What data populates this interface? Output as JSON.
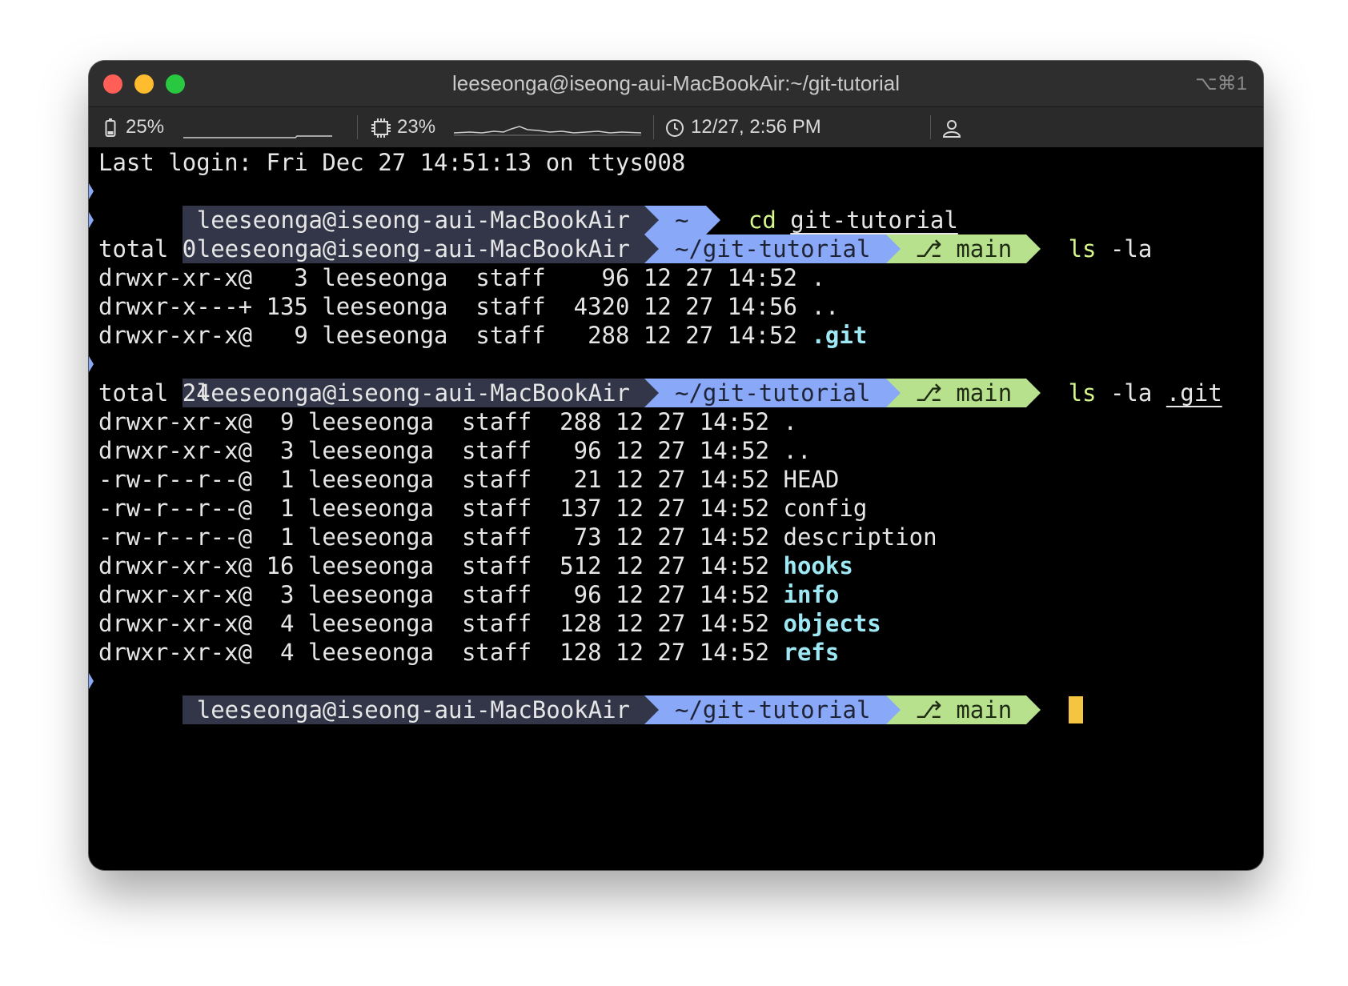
{
  "window": {
    "title": "leeseonga@iseong-aui-MacBookAir:~/git-tutorial",
    "shortcut": "⌥⌘1"
  },
  "statusbar": {
    "battery": "25%",
    "cpu": "23%",
    "datetime": "12/27, 2:56 PM"
  },
  "terminal": {
    "last_login": "Last login: Fri Dec 27 14:51:13 on ttys008",
    "prompt": {
      "user": "leeseonga@iseong-aui-MacBookAir",
      "home": "~",
      "dir": "~/git-tutorial",
      "branch": "main"
    },
    "cmd1": {
      "name": "cd",
      "arg": "git-tutorial"
    },
    "cmd2": {
      "name": "ls",
      "args": "-la"
    },
    "cmd3": {
      "name": "ls",
      "args": "-la",
      "path": ".git"
    },
    "listing1": {
      "total": "total 0",
      "rows": [
        {
          "text": "drwxr-xr-x@   3 leeseonga  staff    96 12 27 14:52 ",
          "name": ".",
          "dir": false
        },
        {
          "text": "drwxr-x---+ 135 leeseonga  staff  4320 12 27 14:56 ",
          "name": "..",
          "dir": false
        },
        {
          "text": "drwxr-xr-x@   9 leeseonga  staff   288 12 27 14:52 ",
          "name": ".git",
          "dir": true
        }
      ]
    },
    "listing2": {
      "total": "total 24",
      "rows": [
        {
          "text": "drwxr-xr-x@  9 leeseonga  staff  288 12 27 14:52 ",
          "name": ".",
          "dir": false
        },
        {
          "text": "drwxr-xr-x@  3 leeseonga  staff   96 12 27 14:52 ",
          "name": "..",
          "dir": false
        },
        {
          "text": "-rw-r--r--@  1 leeseonga  staff   21 12 27 14:52 ",
          "name": "HEAD",
          "dir": false
        },
        {
          "text": "-rw-r--r--@  1 leeseonga  staff  137 12 27 14:52 ",
          "name": "config",
          "dir": false
        },
        {
          "text": "-rw-r--r--@  1 leeseonga  staff   73 12 27 14:52 ",
          "name": "description",
          "dir": false
        },
        {
          "text": "drwxr-xr-x@ 16 leeseonga  staff  512 12 27 14:52 ",
          "name": "hooks",
          "dir": true
        },
        {
          "text": "drwxr-xr-x@  3 leeseonga  staff   96 12 27 14:52 ",
          "name": "info",
          "dir": true
        },
        {
          "text": "drwxr-xr-x@  4 leeseonga  staff  128 12 27 14:52 ",
          "name": "objects",
          "dir": true
        },
        {
          "text": "drwxr-xr-x@  4 leeseonga  staff  128 12 27 14:52 ",
          "name": "refs",
          "dir": true
        }
      ]
    }
  },
  "colors": {
    "user_segment": "#323648",
    "dir_segment": "#8aa8f8",
    "git_segment": "#b8e18d",
    "cursor": "#f5c542",
    "directory_name": "#9ee8f4"
  }
}
